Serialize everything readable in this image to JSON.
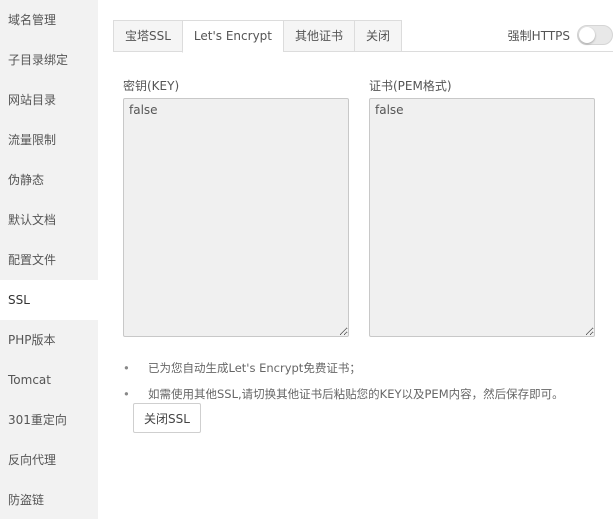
{
  "sidebar": {
    "items": [
      {
        "label": "域名管理"
      },
      {
        "label": "子目录绑定"
      },
      {
        "label": "网站目录"
      },
      {
        "label": "流量限制"
      },
      {
        "label": "伪静态"
      },
      {
        "label": "默认文档"
      },
      {
        "label": "配置文件"
      },
      {
        "label": "SSL"
      },
      {
        "label": "PHP版本"
      },
      {
        "label": "Tomcat"
      },
      {
        "label": "301重定向"
      },
      {
        "label": "反向代理"
      },
      {
        "label": "防盗链"
      }
    ],
    "active": "SSL"
  },
  "tabs": [
    {
      "label": "宝塔SSL"
    },
    {
      "label": "Let's Encrypt"
    },
    {
      "label": "其他证书"
    },
    {
      "label": "关闭"
    }
  ],
  "active_tab": "Let's Encrypt",
  "force_https": {
    "label": "强制HTTPS",
    "enabled": false
  },
  "key_field": {
    "label": "密钥(KEY)",
    "value": "false"
  },
  "pem_field": {
    "label": "证书(PEM格式)",
    "value": "false"
  },
  "notes": [
    "已为您自动生成Let's Encrypt免费证书；",
    "如需使用其他SSL,请切换其他证书后粘贴您的KEY以及PEM内容，然后保存即可。"
  ],
  "close_button": {
    "label": "关闭SSL"
  }
}
